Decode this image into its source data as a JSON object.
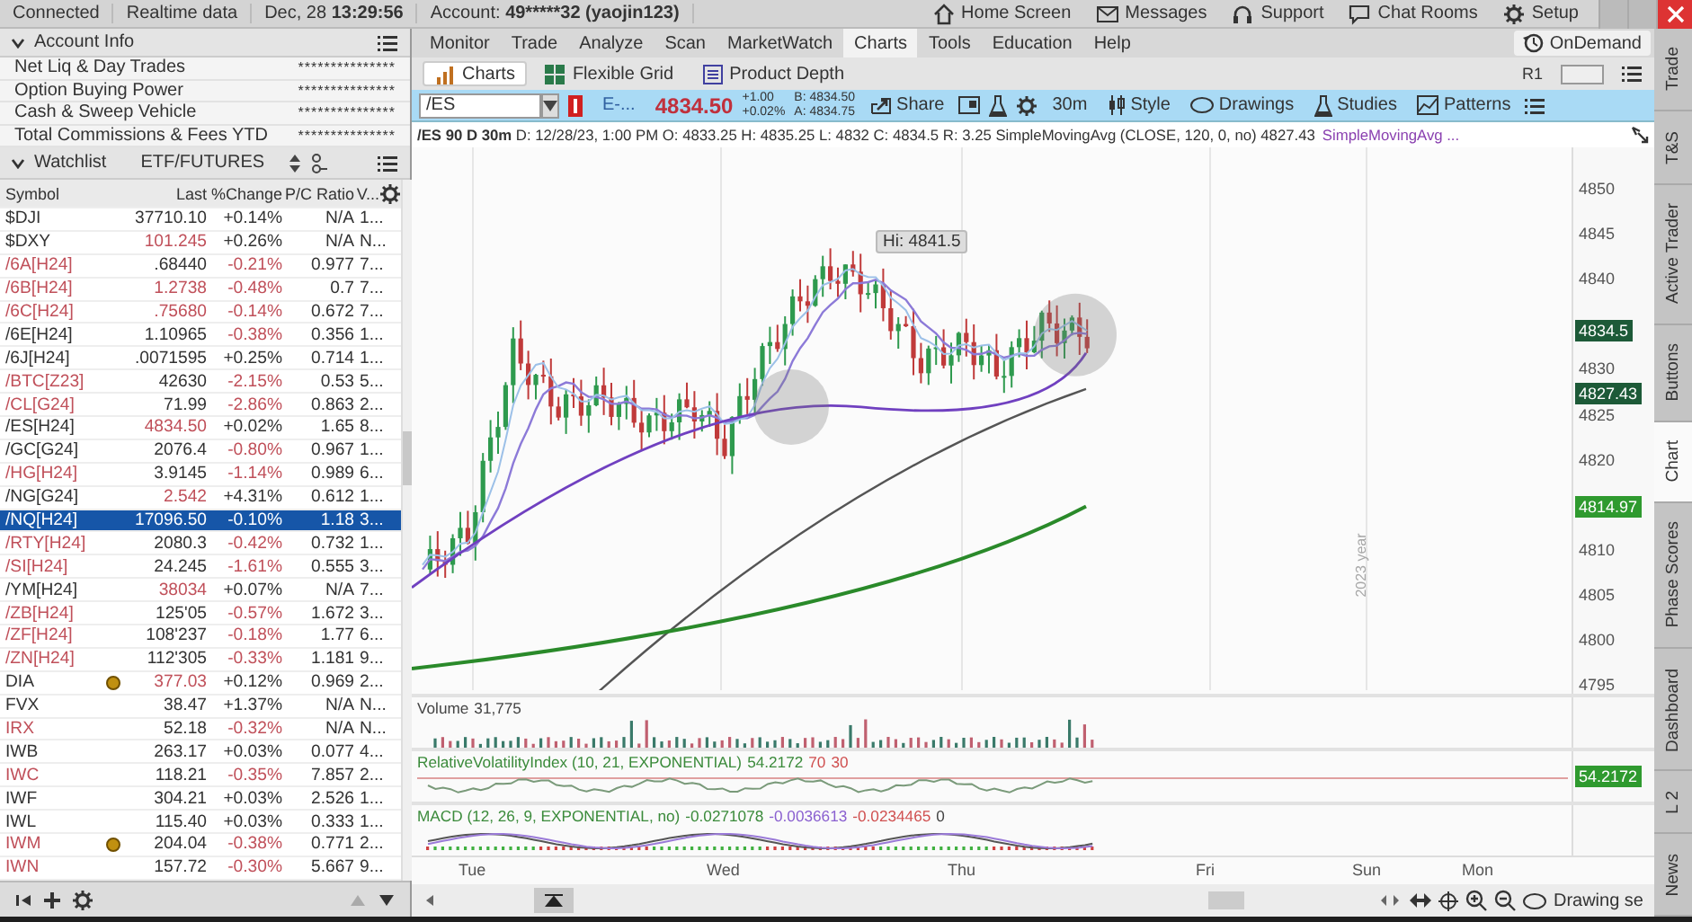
{
  "top_bar": {
    "status": [
      "Connected",
      "Realtime data"
    ],
    "date": "Dec, 28",
    "time": "13:29:56",
    "account_label": "Account:",
    "account": "49*****32 (yaojin123)",
    "links": [
      {
        "label": "Home Screen",
        "kind": "home"
      },
      {
        "label": "Messages",
        "kind": "messages"
      },
      {
        "label": "Support",
        "kind": "support"
      },
      {
        "label": "Chat Rooms",
        "kind": "chat"
      },
      {
        "label": "Setup",
        "kind": "setup"
      }
    ]
  },
  "account_info": {
    "title": "Account Info",
    "rows": [
      {
        "label": "Net Liq & Day Trades",
        "value": "***************"
      },
      {
        "label": "Option Buying Power",
        "value": "***************"
      },
      {
        "label": "Cash & Sweep Vehicle",
        "value": "***************"
      },
      {
        "label": "Total Commissions & Fees YTD",
        "value": "***************"
      }
    ]
  },
  "watchlist": {
    "title": "Watchlist",
    "list_name": "ETF/FUTURES",
    "columns": [
      "Symbol",
      "Last",
      "%Change",
      "P/C Ratio",
      "V..."
    ],
    "rows": [
      {
        "symbol": "$DJI",
        "last": "37710.10",
        "change": "+0.14%",
        "pc_ratio": "N/A",
        "volume": "1...",
        "symbol_down": false,
        "last_down": false,
        "change_down": false,
        "earnings": false,
        "selected": false
      },
      {
        "symbol": "$DXY",
        "last": "101.245",
        "change": "+0.26%",
        "pc_ratio": "N/A",
        "volume": "N...",
        "symbol_down": false,
        "last_down": true,
        "change_down": false,
        "earnings": false,
        "selected": false
      },
      {
        "symbol": "/6A[H24]",
        "last": ".68440",
        "change": "-0.21%",
        "pc_ratio": "0.977",
        "volume": "7...",
        "symbol_down": true,
        "last_down": false,
        "change_down": true,
        "earnings": false,
        "selected": false
      },
      {
        "symbol": "/6B[H24]",
        "last": "1.2738",
        "change": "-0.48%",
        "pc_ratio": "0.7",
        "volume": "7...",
        "symbol_down": true,
        "last_down": true,
        "change_down": true,
        "earnings": false,
        "selected": false
      },
      {
        "symbol": "/6C[H24]",
        "last": ".75680",
        "change": "-0.14%",
        "pc_ratio": "0.672",
        "volume": "7...",
        "symbol_down": true,
        "last_down": true,
        "change_down": true,
        "earnings": false,
        "selected": false
      },
      {
        "symbol": "/6E[H24]",
        "last": "1.10965",
        "change": "-0.38%",
        "pc_ratio": "0.356",
        "volume": "1...",
        "symbol_down": false,
        "last_down": false,
        "change_down": true,
        "earnings": false,
        "selected": false
      },
      {
        "symbol": "/6J[H24]",
        "last": ".0071595",
        "change": "+0.25%",
        "pc_ratio": "0.714",
        "volume": "1...",
        "symbol_down": false,
        "last_down": false,
        "change_down": false,
        "earnings": false,
        "selected": false
      },
      {
        "symbol": "/BTC[Z23]",
        "last": "42630",
        "change": "-2.15%",
        "pc_ratio": "0.53",
        "volume": "5...",
        "symbol_down": true,
        "last_down": false,
        "change_down": true,
        "earnings": false,
        "selected": false
      },
      {
        "symbol": "/CL[G24]",
        "last": "71.99",
        "change": "-2.86%",
        "pc_ratio": "0.863",
        "volume": "2...",
        "symbol_down": true,
        "last_down": false,
        "change_down": true,
        "earnings": false,
        "selected": false
      },
      {
        "symbol": "/ES[H24]",
        "last": "4834.50",
        "change": "+0.02%",
        "pc_ratio": "1.65",
        "volume": "8...",
        "symbol_down": false,
        "last_down": true,
        "change_down": false,
        "earnings": false,
        "selected": false
      },
      {
        "symbol": "/GC[G24]",
        "last": "2076.4",
        "change": "-0.80%",
        "pc_ratio": "0.967",
        "volume": "1...",
        "symbol_down": false,
        "last_down": false,
        "change_down": true,
        "earnings": false,
        "selected": false
      },
      {
        "symbol": "/HG[H24]",
        "last": "3.9145",
        "change": "-1.14%",
        "pc_ratio": "0.989",
        "volume": "6...",
        "symbol_down": true,
        "last_down": false,
        "change_down": true,
        "earnings": false,
        "selected": false
      },
      {
        "symbol": "/NG[G24]",
        "last": "2.542",
        "change": "+4.31%",
        "pc_ratio": "0.612",
        "volume": "1...",
        "symbol_down": false,
        "last_down": true,
        "change_down": false,
        "earnings": false,
        "selected": false
      },
      {
        "symbol": "/NQ[H24]",
        "last": "17096.50",
        "change": "-0.10%",
        "pc_ratio": "1.18",
        "volume": "3...",
        "earnings": false,
        "selected": true
      },
      {
        "symbol": "/RTY[H24]",
        "last": "2080.3",
        "change": "-0.42%",
        "pc_ratio": "0.732",
        "volume": "1...",
        "symbol_down": true,
        "last_down": false,
        "change_down": true,
        "earnings": false,
        "selected": false
      },
      {
        "symbol": "/SI[H24]",
        "last": "24.245",
        "change": "-1.61%",
        "pc_ratio": "0.555",
        "volume": "3...",
        "symbol_down": true,
        "last_down": false,
        "change_down": true,
        "earnings": false,
        "selected": false
      },
      {
        "symbol": "/YM[H24]",
        "last": "38034",
        "change": "+0.07%",
        "pc_ratio": "N/A",
        "volume": "7...",
        "symbol_down": false,
        "last_down": true,
        "change_down": false,
        "earnings": false,
        "selected": false
      },
      {
        "symbol": "/ZB[H24]",
        "last": "125'05",
        "change": "-0.57%",
        "pc_ratio": "1.672",
        "volume": "3...",
        "symbol_down": true,
        "last_down": false,
        "change_down": true,
        "earnings": false,
        "selected": false
      },
      {
        "symbol": "/ZF[H24]",
        "last": "108'237",
        "change": "-0.18%",
        "pc_ratio": "1.77",
        "volume": "6...",
        "symbol_down": true,
        "last_down": false,
        "change_down": true,
        "earnings": false,
        "selected": false
      },
      {
        "symbol": "/ZN[H24]",
        "last": "112'305",
        "change": "-0.33%",
        "pc_ratio": "1.181",
        "volume": "9...",
        "symbol_down": true,
        "last_down": false,
        "change_down": true,
        "earnings": false,
        "selected": false
      },
      {
        "symbol": "DIA",
        "last": "377.03",
        "change": "+0.12%",
        "pc_ratio": "0.969",
        "volume": "2...",
        "symbol_down": false,
        "last_down": true,
        "change_down": false,
        "earnings": true,
        "selected": false
      },
      {
        "symbol": "FVX",
        "last": "38.47",
        "change": "+1.37%",
        "pc_ratio": "N/A",
        "volume": "N...",
        "symbol_down": false,
        "last_down": false,
        "change_down": false,
        "earnings": false,
        "selected": false
      },
      {
        "symbol": "IRX",
        "last": "52.18",
        "change": "-0.32%",
        "pc_ratio": "N/A",
        "volume": "N...",
        "symbol_down": true,
        "last_down": false,
        "change_down": true,
        "earnings": false,
        "selected": false
      },
      {
        "symbol": "IWB",
        "last": "263.17",
        "change": "+0.03%",
        "pc_ratio": "0.077",
        "volume": "4...",
        "symbol_down": false,
        "last_down": false,
        "change_down": false,
        "earnings": false,
        "selected": false
      },
      {
        "symbol": "IWC",
        "last": "118.21",
        "change": "-0.35%",
        "pc_ratio": "7.857",
        "volume": "2...",
        "symbol_down": true,
        "last_down": false,
        "change_down": true,
        "earnings": false,
        "selected": false
      },
      {
        "symbol": "IWF",
        "last": "304.21",
        "change": "+0.03%",
        "pc_ratio": "2.526",
        "volume": "1...",
        "symbol_down": false,
        "last_down": false,
        "change_down": false,
        "earnings": false,
        "selected": false
      },
      {
        "symbol": "IWL",
        "last": "115.40",
        "change": "+0.03%",
        "pc_ratio": "0.333",
        "volume": "1...",
        "symbol_down": false,
        "last_down": false,
        "change_down": false,
        "earnings": false,
        "selected": false
      },
      {
        "symbol": "IWM",
        "last": "204.04",
        "change": "-0.38%",
        "pc_ratio": "0.771",
        "volume": "2...",
        "symbol_down": true,
        "last_down": false,
        "change_down": true,
        "earnings": true,
        "selected": false
      },
      {
        "symbol": "IWN",
        "last": "157.72",
        "change": "-0.30%",
        "pc_ratio": "5.667",
        "volume": "9...",
        "symbol_down": true,
        "last_down": false,
        "change_down": true,
        "earnings": false,
        "selected": false
      }
    ]
  },
  "nav_tabs": [
    {
      "label": "Monitor",
      "selected": false
    },
    {
      "label": "Trade",
      "selected": false
    },
    {
      "label": "Analyze",
      "selected": false
    },
    {
      "label": "Scan",
      "selected": false
    },
    {
      "label": "MarketWatch",
      "selected": false
    },
    {
      "label": "Charts",
      "selected": true
    },
    {
      "label": "Tools",
      "selected": false
    },
    {
      "label": "Education",
      "selected": false
    },
    {
      "label": "Help",
      "selected": false
    }
  ],
  "on_demand": "OnDemand",
  "sub_tabs": [
    {
      "label": "Charts",
      "kind": "charts",
      "selected": true
    },
    {
      "label": "Flexible Grid",
      "kind": "grid",
      "selected": false
    },
    {
      "label": "Product Depth",
      "kind": "depth",
      "selected": false
    }
  ],
  "layout_name": "R1",
  "chart_toolbar": {
    "symbol": "/ES",
    "description": "E-...",
    "price": "4834.50",
    "change": "+1.00",
    "change_pct": "+0.02%",
    "bid": "B: 4834.50",
    "ask": "A: 4834.75",
    "share": "Share",
    "interval": "30m",
    "style": "Style",
    "drawings": "Drawings",
    "studies": "Studies",
    "patterns": "Patterns"
  },
  "chart_info": {
    "summary": "**/ES 90 D 30m** D: 12/28/23, 1:00 PM O: 4833.25 H: 4835.25 L: 4832 C: 4834.5 R: 3.25 SimpleMovingAvg (CLOSE, 120, 0, no) 4827.43",
    "second_study": "SimpleMovingAvg ..."
  },
  "price_chart": {
    "high_label": "Hi: 4841.5",
    "year_label": "2023 year",
    "axis": [
      "4850",
      "4845",
      "4840",
      "4830",
      "4825",
      "4820",
      "4810",
      "4805",
      "4800",
      "4795"
    ],
    "markers": [
      {
        "label": "4834.5",
        "color": "#1d5a38"
      },
      {
        "label": "4827.43",
        "color": "#1d5a38"
      },
      {
        "label": "4814.97",
        "color": "#2f9a2f"
      }
    ]
  },
  "volume_study": {
    "name": "Volume",
    "value": "31,775"
  },
  "rvi_study": {
    "name": "RelativeVolatilityIndex (10, 21, EXPONENTIAL)",
    "value": "54.2172",
    "upper": "70",
    "lower": "30",
    "marker": "54.2172"
  },
  "macd_study": {
    "name": "MACD (12, 26, 9, EXPONENTIAL, no)",
    "value": "-0.0271078",
    "average": "-0.0036613",
    "diff": "-0.0234465",
    "zero": "0"
  },
  "time_axis": [
    "Tue",
    "Wed",
    "Thu",
    "Fri",
    "Sun",
    "Mon"
  ],
  "drawing_set": "Drawing se",
  "side_tabs": [
    {
      "label": "Trade",
      "selected": false
    },
    {
      "label": "T&S",
      "selected": false
    },
    {
      "label": "Active Trader",
      "selected": false
    },
    {
      "label": "Buttons",
      "selected": false
    },
    {
      "label": "Chart",
      "selected": true
    },
    {
      "label": "Phase Scores",
      "selected": false
    },
    {
      "label": "Dashboard",
      "selected": false
    },
    {
      "label": "L 2",
      "selected": false
    },
    {
      "label": "News",
      "selected": false
    }
  ]
}
